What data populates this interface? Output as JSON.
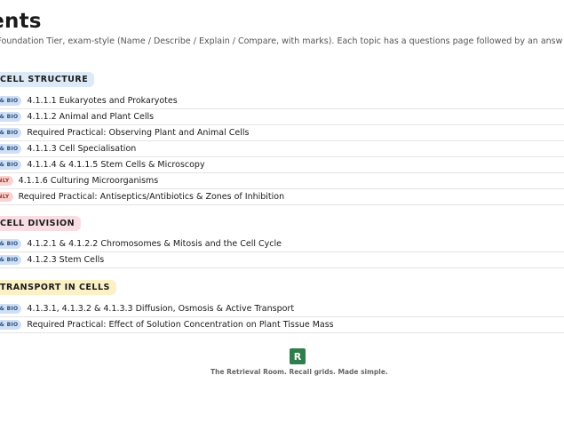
{
  "title": "tents",
  "intro": "are Foundation Tier, exam-style (Name / Describe / Explain / Compare, with marks). Each topic has a questions page followed by an answ",
  "sections": [
    {
      "heading": "CELL STRUCTURE",
      "rows": [
        {
          "badge": "D & BIO",
          "text": "4.1.1.1 Eukaryotes and Prokaryotes"
        },
        {
          "badge": "D & BIO",
          "text": "4.1.1.2 Animal and Plant Cells"
        },
        {
          "badge": "D & BIO",
          "text": "Required Practical: Observing Plant and Animal Cells"
        },
        {
          "badge": "D & BIO",
          "text": "4.1.1.3 Cell Specialisation"
        },
        {
          "badge": "D & BIO",
          "text": "4.1.1.4 & 4.1.1.5 Stem Cells & Microscopy"
        },
        {
          "badge": "ONLY",
          "text": "4.1.1.6 Culturing Microorganisms"
        },
        {
          "badge": "ONLY",
          "text": "Required Practical: Antiseptics/Antibiotics & Zones of Inhibition"
        }
      ]
    },
    {
      "heading": "CELL DIVISION",
      "rows": [
        {
          "badge": "D & BIO",
          "text": "4.1.2.1 & 4.1.2.2 Chromosomes & Mitosis and the Cell Cycle"
        },
        {
          "badge": "D & BIO",
          "text": "4.1.2.3 Stem Cells"
        }
      ]
    },
    {
      "heading": "TRANSPORT IN CELLS",
      "rows": [
        {
          "badge": "D & BIO",
          "text": "4.1.3.1, 4.1.3.2 & 4.1.3.3 Diffusion, Osmosis & Active Transport"
        },
        {
          "badge": "D & BIO",
          "text": "Required Practical: Effect of Solution Concentration on Plant Tissue Mass"
        }
      ]
    }
  ],
  "footer": {
    "logo_letter": "R",
    "tagline": "The Retrieval Room. Recall grids. Made simple."
  }
}
